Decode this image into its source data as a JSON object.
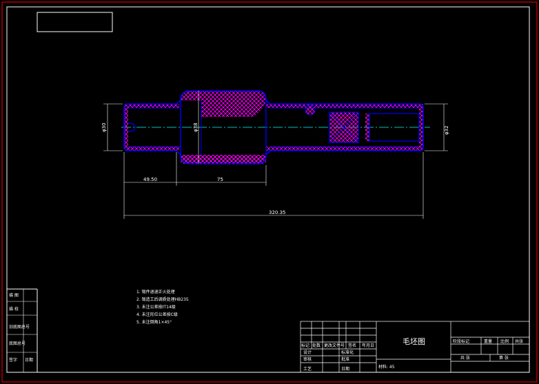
{
  "drawing_title": "毛坯图",
  "material_label": "材料: 45",
  "dimensions": {
    "d_left": "φ30",
    "d_mid": "φ38",
    "d_right": "φ32",
    "len_a": "49.50",
    "len_b": "75",
    "len_total": "320.35"
  },
  "notes": [
    "1. 锻件退退正火处理",
    "2. 锻造工后调质处理HB235",
    "3. 未注公差按IT14级",
    "4. 未注形位公差按C级",
    "5. 未注倒角1×45°"
  ],
  "left_strip": [
    "描 图",
    "描 校",
    "旧底图总号",
    "底图总号",
    "签字",
    "日期"
  ],
  "title_block": {
    "row_labels": [
      "标记",
      "处数",
      "分区",
      "更改文件号",
      "签名",
      "年月日"
    ],
    "design_rows": [
      "设计",
      "审核",
      "工艺"
    ],
    "standardize": "标准化",
    "approve": "批准",
    "date_label": "日期",
    "stage_labels": [
      "阶段标记",
      "重量",
      "比例",
      "共张"
    ],
    "sheet_labels": [
      "共 张",
      "第 张"
    ]
  },
  "colors": {
    "frame": "#ff0000",
    "outline": "#0000ff",
    "hatch": "#ff00ff",
    "dim": "#ffffff",
    "center": "#00ffff",
    "background": "#000000"
  }
}
